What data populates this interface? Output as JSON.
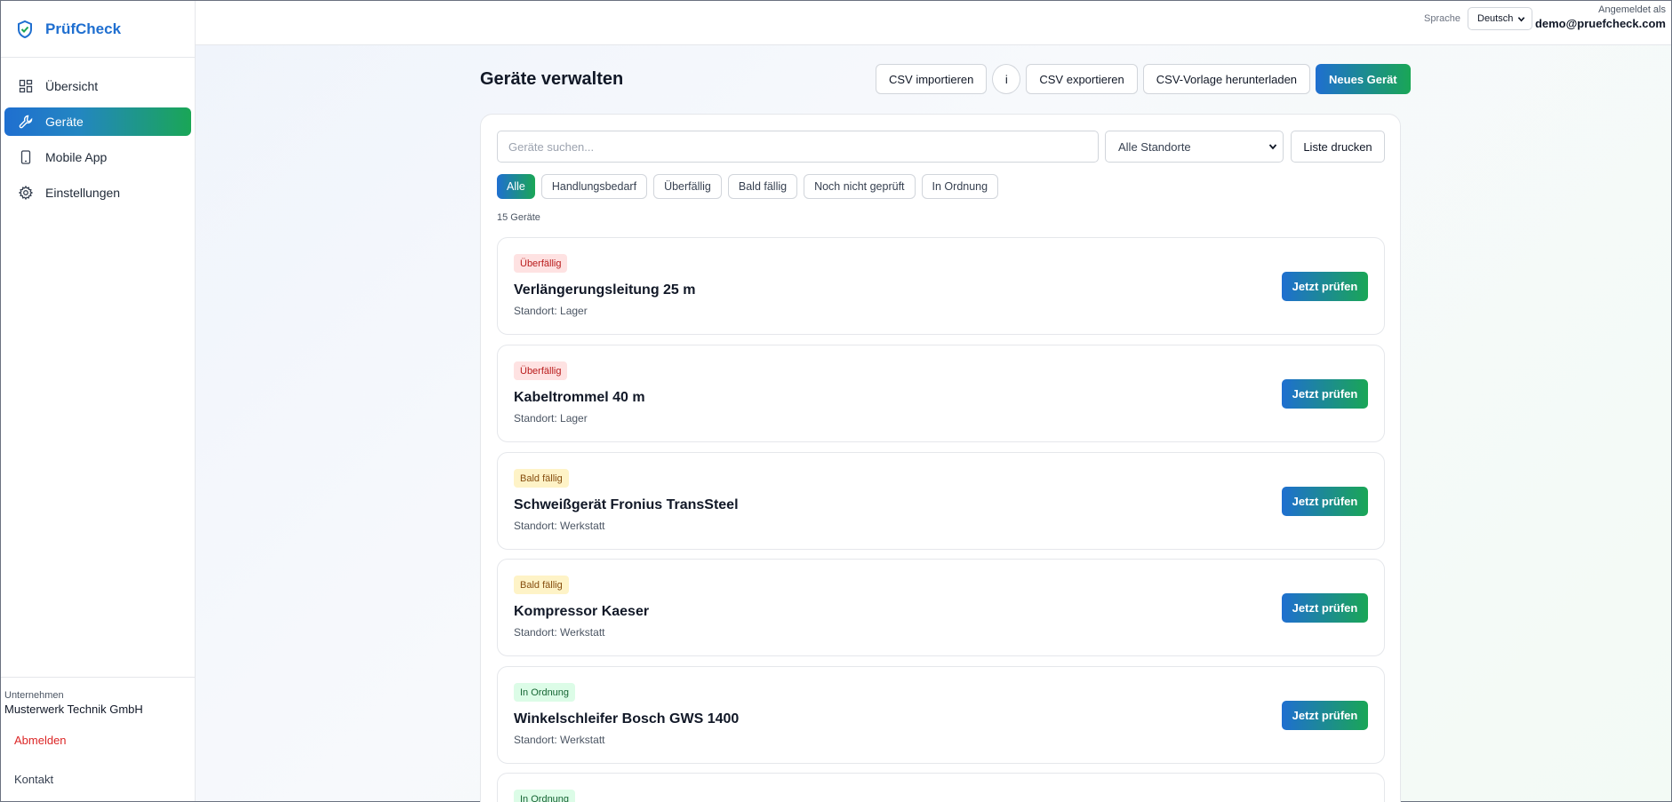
{
  "app": {
    "name": "PrüfCheck"
  },
  "sidebar": {
    "items": [
      {
        "label": "Übersicht",
        "icon": "grid-icon",
        "active": false
      },
      {
        "label": "Geräte",
        "icon": "wrench-icon",
        "active": true
      },
      {
        "label": "Mobile App",
        "icon": "smartphone-icon",
        "active": false
      },
      {
        "label": "Einstellungen",
        "icon": "gear-icon",
        "active": false
      }
    ],
    "company_label": "Unternehmen",
    "company_name": "Musterwerk Technik GmbH",
    "logout": "Abmelden",
    "contact": "Kontakt"
  },
  "topbar": {
    "language_label": "Sprache",
    "language_value": "Deutsch",
    "user_label": "Angemeldet als",
    "user_email": "demo@pruefcheck.com"
  },
  "page": {
    "title": "Geräte verwalten",
    "buttons": {
      "import": "CSV importieren",
      "info": "i",
      "export": "CSV exportieren",
      "template": "CSV-Vorlage herunterladen",
      "new": "Neues Gerät"
    },
    "search_placeholder": "Geräte suchen...",
    "location_filter": "Alle Standorte",
    "print": "Liste drucken",
    "filters": [
      "Alle",
      "Handlungsbedarf",
      "Überfällig",
      "Bald fällig",
      "Noch nicht geprüft",
      "In Ordnung"
    ],
    "active_filter": "Alle",
    "count": "15 Geräte"
  },
  "devices": [
    {
      "status": "Überfällig",
      "status_color": "red",
      "name": "Verlängerungsleitung 25 m",
      "location": "Standort: Lager",
      "action": "Jetzt prüfen"
    },
    {
      "status": "Überfällig",
      "status_color": "red",
      "name": "Kabeltrommel 40 m",
      "location": "Standort: Lager",
      "action": "Jetzt prüfen"
    },
    {
      "status": "Bald fällig",
      "status_color": "yellow",
      "name": "Schweißgerät Fronius TransSteel",
      "location": "Standort: Werkstatt",
      "action": "Jetzt prüfen"
    },
    {
      "status": "Bald fällig",
      "status_color": "yellow",
      "name": "Kompressor Kaeser",
      "location": "Standort: Werkstatt",
      "action": "Jetzt prüfen"
    },
    {
      "status": "In Ordnung",
      "status_color": "green",
      "name": "Winkelschleifer Bosch GWS 1400",
      "location": "Standort: Werkstatt",
      "action": "Jetzt prüfen"
    },
    {
      "status": "In Ordnung",
      "status_color": "green",
      "name": "",
      "location": "",
      "action": ""
    }
  ]
}
